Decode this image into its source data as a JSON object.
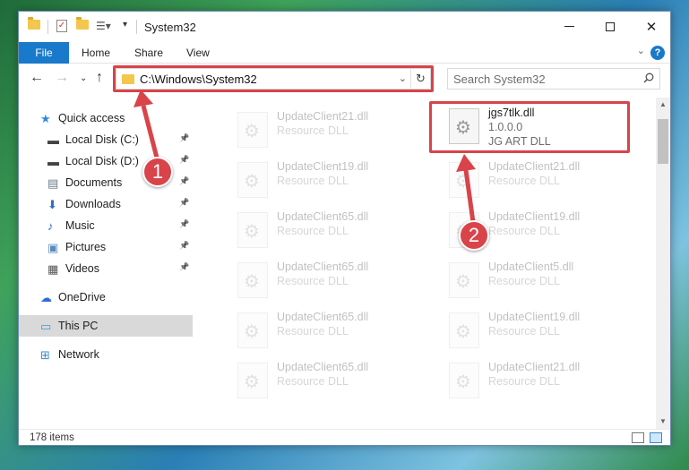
{
  "window": {
    "title": "System32",
    "minimize_glyph": "",
    "maximize_glyph": "",
    "close_glyph": "✕"
  },
  "ribbon": {
    "tabs": [
      "File",
      "Home",
      "Share",
      "View"
    ],
    "help": "?"
  },
  "nav": {
    "address": "C:\\Windows\\System32",
    "search_placeholder": "Search System32"
  },
  "sidebar": {
    "items": [
      {
        "label": "Quick access",
        "icon": "star-icon",
        "pinned": false
      },
      {
        "label": "Local Disk (C:)",
        "icon": "drive-icon",
        "pinned": true
      },
      {
        "label": "Local Disk (D:)",
        "icon": "drive-icon",
        "pinned": true
      },
      {
        "label": "Documents",
        "icon": "documents-icon",
        "pinned": true
      },
      {
        "label": "Downloads",
        "icon": "download-icon",
        "pinned": true
      },
      {
        "label": "Music",
        "icon": "music-icon",
        "pinned": true
      },
      {
        "label": "Pictures",
        "icon": "pictures-icon",
        "pinned": true
      },
      {
        "label": "Videos",
        "icon": "videos-icon",
        "pinned": true
      },
      {
        "label": "OneDrive",
        "icon": "cloud-icon",
        "pinned": false
      },
      {
        "label": "This PC",
        "icon": "computer-icon",
        "pinned": false,
        "selected": true
      },
      {
        "label": "Network",
        "icon": "network-icon",
        "pinned": false
      }
    ]
  },
  "files": {
    "left": [
      {
        "name": "UpdateClient21.dll",
        "type": "Resource DLL"
      },
      {
        "name": "UpdateClient19.dll",
        "type": "Resource DLL"
      },
      {
        "name": "UpdateClient65.dll",
        "type": "Resource DLL"
      },
      {
        "name": "UpdateClient65.dll",
        "type": "Resource DLL"
      },
      {
        "name": "UpdateClient65.dll",
        "type": "Resource DLL"
      },
      {
        "name": "UpdateClient65.dll",
        "type": "Resource DLL"
      }
    ],
    "right_highlighted": {
      "name": "jgs7tlk.dll",
      "version": "1.0.0.0",
      "type": "JG ART DLL"
    },
    "right": [
      {
        "name": "UpdateClient21.dll",
        "type": "Resource DLL"
      },
      {
        "name": "UpdateClient19.dll",
        "type": "Resource DLL"
      },
      {
        "name": "UpdateClient5.dll",
        "type": "Resource DLL"
      },
      {
        "name": "UpdateClient19.dll",
        "type": "Resource DLL"
      },
      {
        "name": "UpdateClient21.dll",
        "type": "Resource DLL"
      }
    ]
  },
  "status": {
    "item_count": "178 items"
  },
  "callouts": [
    "1",
    "2"
  ],
  "colors": {
    "accent": "#1979ca",
    "highlight": "#d9434a",
    "folder": "#f3c64e",
    "selected": "#d9d9d9"
  }
}
